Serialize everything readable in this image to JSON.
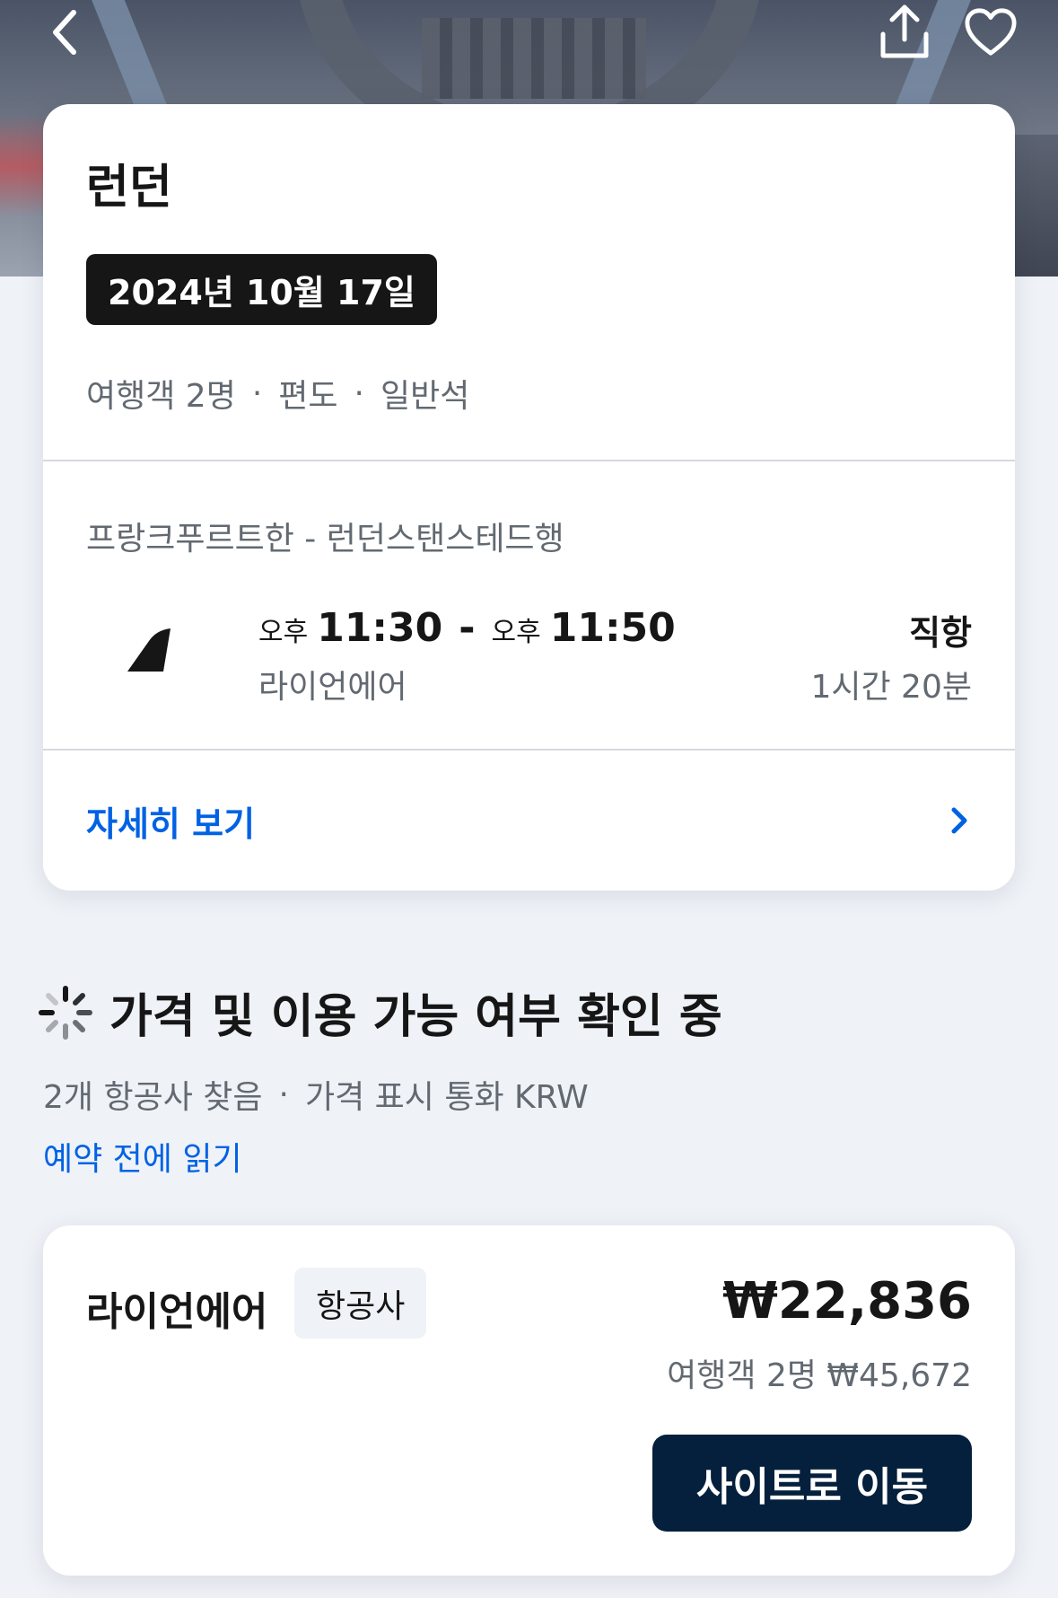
{
  "header": {
    "back_icon": "chevron-left-icon",
    "share_icon": "share-upload-icon",
    "favorite_icon": "heart-outline-icon"
  },
  "trip": {
    "city": "런던",
    "date": "2024년 10월 17일",
    "travelers": "여행객 2명",
    "trip_type": "편도",
    "cabin": "일반석",
    "separator": "·"
  },
  "flight": {
    "route": "프랑크푸르트한 - 런던스탠스테드행",
    "depart_ampm": "오후",
    "depart_time": "11:30",
    "dash": "-",
    "arrive_ampm": "오후",
    "arrive_time": "11:50",
    "airline": "라이언에어",
    "stops": "직항",
    "duration": "1시간 20분",
    "airline_icon": "airline-tail-icon"
  },
  "details": {
    "label": "자세히 보기",
    "icon": "chevron-right-icon"
  },
  "loading": {
    "title": "가격 및 이용 가능 여부 확인 중",
    "icon": "spinner-icon",
    "found": "2개 항공사 찾음",
    "currency": "가격 표시 통화 KRW",
    "read_link": "예약 전에 읽기"
  },
  "offer": {
    "airline": "라이언에어",
    "tag": "항공사",
    "price": "₩22,836",
    "total": "여행객 2명 ₩45,672",
    "button": "사이트로 이동"
  },
  "colors": {
    "accent_blue": "#0062e3",
    "button_navy": "#05203c",
    "background": "#eff2f7",
    "text_dark": "#161616",
    "text_muted": "#626971"
  }
}
